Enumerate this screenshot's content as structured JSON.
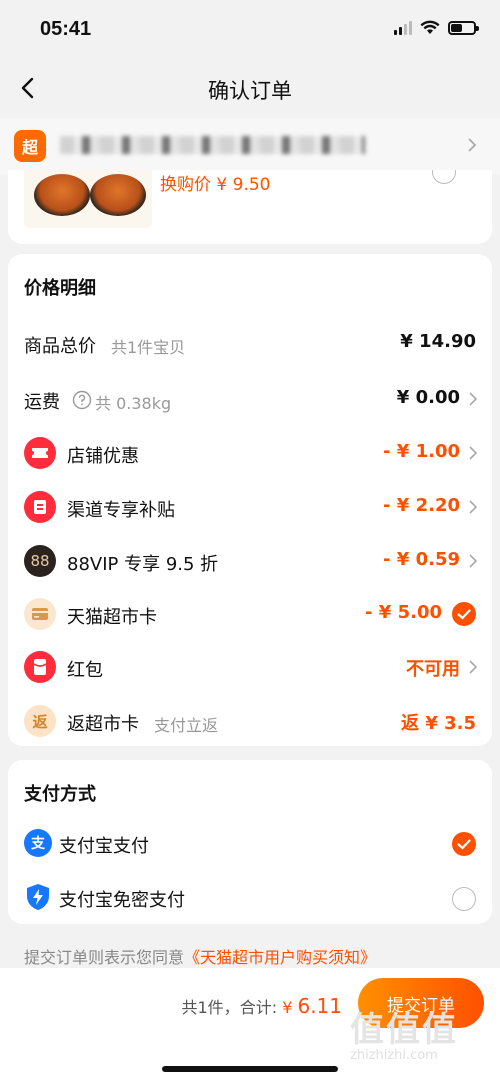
{
  "status_bar": {
    "time": "05:41"
  },
  "nav": {
    "title": "确认订单"
  },
  "store": {
    "logo_char": "超"
  },
  "product": {
    "price_text": "换购价 ¥ 9.50"
  },
  "price_detail": {
    "title": "价格明细",
    "rows": [
      {
        "label": "商品总价",
        "sub": "共1件宝贝",
        "value": "¥ 14.90"
      },
      {
        "label": "运费",
        "sub": "共 0.38kg",
        "value": "¥ 0.00"
      },
      {
        "label": "店铺优惠",
        "value": "- ¥ 1.00"
      },
      {
        "label": "渠道专享补贴",
        "value": "- ¥ 2.20"
      },
      {
        "label": "88VIP 专享 9.5 折",
        "value": "- ¥ 0.59",
        "icon_text": "88"
      },
      {
        "label": "天猫超市卡",
        "value": "- ¥ 5.00"
      },
      {
        "label": "红包",
        "value": "不可用"
      },
      {
        "label": "返超市卡",
        "sub": "支付立返",
        "value": "返 ¥ 3.5",
        "icon_text": "返"
      }
    ]
  },
  "payment": {
    "title": "支付方式",
    "methods": [
      {
        "label": "支付宝支付",
        "icon_text": "支",
        "selected": true
      },
      {
        "label": "支付宝免密支付",
        "selected": false
      }
    ]
  },
  "agreement": {
    "text": "提交订单则表示您同意",
    "link": "《天猫超市用户购买须知》"
  },
  "bottom_bar": {
    "count": "共1件，",
    "total_label": "合计:",
    "currency": "¥",
    "total": "6.11",
    "submit": "提交订单"
  },
  "watermark": {
    "big": "值值值",
    "small": "zhizhizhi.com"
  },
  "colors": {
    "accent": "#ff5000",
    "bg": "#f2f2f2"
  }
}
